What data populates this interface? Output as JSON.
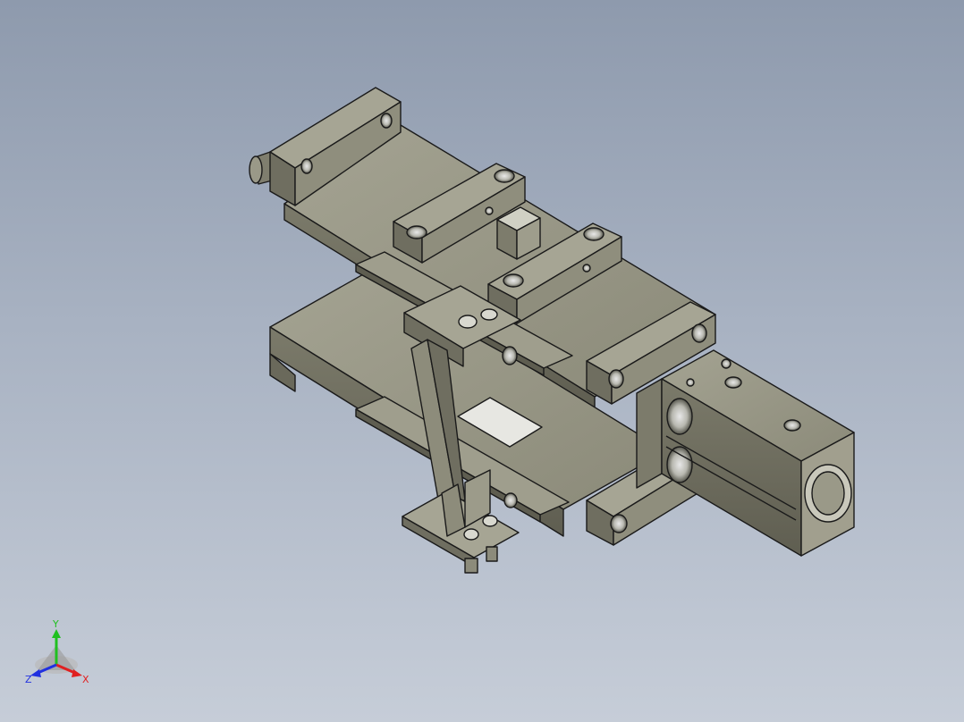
{
  "view": {
    "background_top": "#8e9aad",
    "background_bottom": "#c6cdd8",
    "part_color": "#8f8e7d",
    "part_dark": "#6e6d5f",
    "part_light": "#a9a897",
    "edge_color": "#1a1a1a"
  },
  "triad": {
    "x_label": "X",
    "y_label": "Y",
    "z_label": "Z",
    "x_color": "#e02020",
    "y_color": "#20c020",
    "z_color": "#2030e0"
  }
}
